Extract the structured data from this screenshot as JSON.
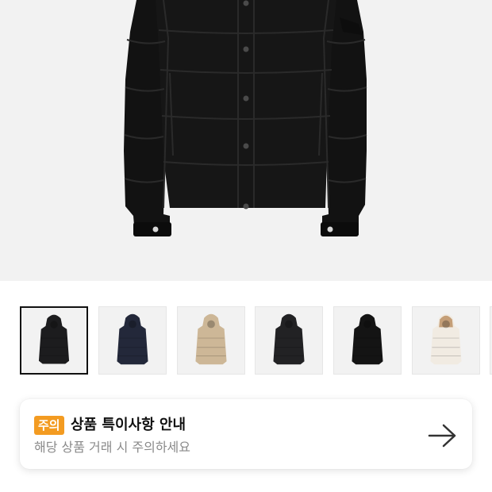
{
  "product": {
    "main_image": "black-hooded-puffer-jacket",
    "thumbnails": [
      {
        "name": "black-jacket-thumbnail",
        "color": "#1c1c1e",
        "hood": "#1c1c1e",
        "selected": true
      },
      {
        "name": "navy-jacket-thumbnail",
        "color": "#23283a",
        "hood": "#23283a",
        "selected": false
      },
      {
        "name": "beige-jacket-thumbnail",
        "color": "#cdb797",
        "hood": "#cdb797",
        "selected": false
      },
      {
        "name": "black-jacket-thumbnail-2",
        "color": "#222224",
        "hood": "#222224",
        "selected": false
      },
      {
        "name": "black-jacket-thumbnail-3",
        "color": "#141414",
        "hood": "#141414",
        "selected": false
      },
      {
        "name": "white-jacket-thumbnail",
        "color": "#f1ebe2",
        "hood": "#c59f78",
        "selected": false
      }
    ]
  },
  "notice": {
    "badge": "주의",
    "title": "상품 특이사항 안내",
    "subtitle": "해당 상품 거래 시 주의하세요",
    "arrow_icon": "arrow-right-icon",
    "badge_color": "#f39b21"
  }
}
